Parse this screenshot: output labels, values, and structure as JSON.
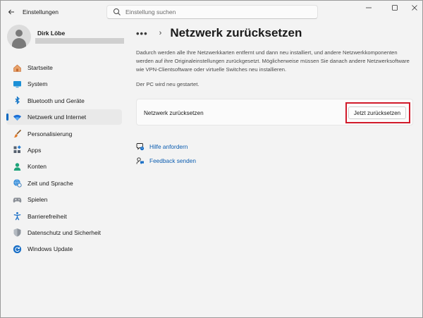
{
  "window": {
    "title": "Einstellungen"
  },
  "search": {
    "placeholder": "Einstellung suchen"
  },
  "profile": {
    "name": "Dirk Löbe"
  },
  "sidebar": {
    "items": [
      {
        "label": "Startseite",
        "icon": "home-icon",
        "active": false
      },
      {
        "label": "System",
        "icon": "monitor-icon",
        "active": false
      },
      {
        "label": "Bluetooth und Geräte",
        "icon": "bluetooth-icon",
        "active": false
      },
      {
        "label": "Netzwerk und Internet",
        "icon": "wifi-icon",
        "active": true
      },
      {
        "label": "Personalisierung",
        "icon": "brush-icon",
        "active": false
      },
      {
        "label": "Apps",
        "icon": "apps-icon",
        "active": false
      },
      {
        "label": "Konten",
        "icon": "person-icon",
        "active": false
      },
      {
        "label": "Zeit und Sprache",
        "icon": "globe-clock-icon",
        "active": false
      },
      {
        "label": "Spielen",
        "icon": "gamepad-icon",
        "active": false
      },
      {
        "label": "Barrierefreiheit",
        "icon": "accessibility-icon",
        "active": false
      },
      {
        "label": "Datenschutz und Sicherheit",
        "icon": "shield-icon",
        "active": false
      },
      {
        "label": "Windows Update",
        "icon": "update-icon",
        "active": false
      }
    ]
  },
  "main": {
    "breadcrumb_more": "•••",
    "breadcrumb_separator": "›",
    "title": "Netzwerk zurücksetzen",
    "description": "Dadurch werden alle Ihre Netzwerkkarten entfernt und dann neu installiert, und andere Netzwerkkomponenten werden auf ihre Originaleinstellungen zurückgesetzt. Möglicherweise müssen Sie danach andere Netzwerksoftware wie VPN-Clientsoftware oder virtuelle Switches neu installieren.",
    "restart_note": "Der PC wird neu gestartet.",
    "card": {
      "label": "Netzwerk zurücksetzen",
      "button": "Jetzt zurücksetzen"
    },
    "links": [
      {
        "label": "Hilfe anfordern",
        "icon": "help-chat-icon"
      },
      {
        "label": "Feedback senden",
        "icon": "feedback-icon"
      }
    ]
  },
  "colors": {
    "accent": "#0067c0",
    "highlight": "#d11a2a",
    "link": "#0a5cb0"
  }
}
